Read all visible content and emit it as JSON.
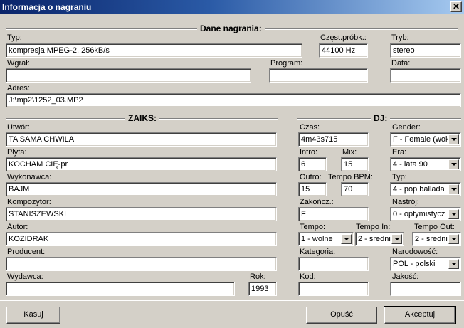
{
  "window": {
    "title": "Informacja o nagraniu",
    "close_glyph": "✕"
  },
  "sections": {
    "recording": "Dane nagrania:",
    "zaiks": "ZAIKS:",
    "dj": "DJ:"
  },
  "recording": {
    "typ": {
      "label": "Typ:",
      "value": "kompresja MPEG-2,    256kB/s"
    },
    "sample": {
      "label": "Częst.próbk.:",
      "value": "44100 Hz"
    },
    "mode": {
      "label": "Tryb:",
      "value": "stereo"
    },
    "loader": {
      "label": "Wgrał:",
      "value": ""
    },
    "program": {
      "label": "Program:",
      "value": ""
    },
    "date": {
      "label": "Data:",
      "value": ""
    },
    "address": {
      "label": "Adres:",
      "value": "J:\\mp2\\1252_03.MP2"
    }
  },
  "zaiks": {
    "title": {
      "label": "Utwór:",
      "value": "TA SAMA CHWILA"
    },
    "album": {
      "label": "Płyta:",
      "value": "KOCHAM CIĘ-pr"
    },
    "performer": {
      "label": "Wykonawca:",
      "value": "BAJM"
    },
    "composer": {
      "label": "Kompozytor:",
      "value": "STANISZEWSKI"
    },
    "author": {
      "label": "Autor:",
      "value": "KOZIDRAK"
    },
    "producer": {
      "label": "Producent:",
      "value": ""
    },
    "publisher": {
      "label": "Wydawca:",
      "value": ""
    },
    "year": {
      "label": "Rok:",
      "value": "1993"
    }
  },
  "dj": {
    "time": {
      "label": "Czas:",
      "value": "4m43s715"
    },
    "intro": {
      "label": "Intro:",
      "value": "6"
    },
    "mix": {
      "label": "Mix:",
      "value": "15"
    },
    "outro": {
      "label": "Outro:",
      "value": "15"
    },
    "bpm": {
      "label": "Tempo BPM:",
      "value": "70"
    },
    "ending": {
      "label": "Zakończ.:",
      "value": "F"
    },
    "tempo": {
      "label": "Tempo:",
      "value": "1 - wolne"
    },
    "tempo_in": {
      "label": "Tempo In:",
      "value": "2 - średni"
    },
    "tempo_out": {
      "label": "Tempo Out:",
      "value": "2 - średni"
    },
    "category": {
      "label": "Kategoria:",
      "value": ""
    },
    "code": {
      "label": "Kod:",
      "value": ""
    },
    "gender": {
      "label": "Gender:",
      "value": "F - Female (wok"
    },
    "era": {
      "label": "Era:",
      "value": "4 - lata 90"
    },
    "type": {
      "label": "Typ:",
      "value": "4 - pop ballada"
    },
    "mood": {
      "label": "Nastrój:",
      "value": "0 - optymistycz"
    },
    "nationality": {
      "label": "Narodowość:",
      "value": "POL - polski"
    },
    "quality": {
      "label": "Jakość:",
      "value": ""
    }
  },
  "buttons": {
    "clear": "Kasuj",
    "cancel": "Opuść",
    "accept": "Akceptuj"
  }
}
